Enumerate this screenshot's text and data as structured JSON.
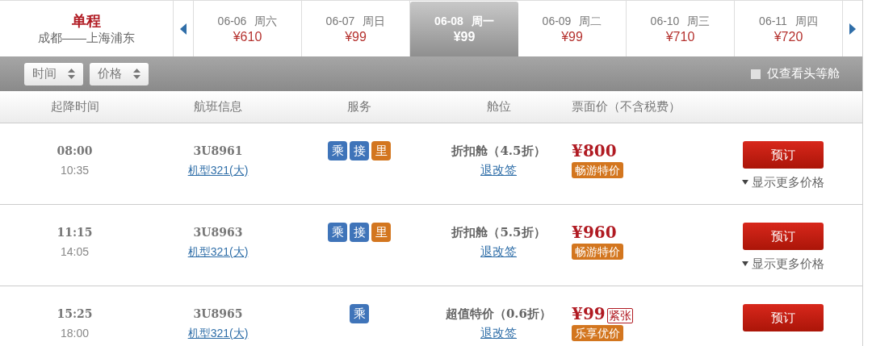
{
  "trip": {
    "type": "单程",
    "route": "成都——上海浦东"
  },
  "dates": [
    {
      "date": "06-06",
      "weekday": "周六",
      "price": "¥610",
      "selected": false
    },
    {
      "date": "06-07",
      "weekday": "周日",
      "price": "¥99",
      "selected": false
    },
    {
      "date": "06-08",
      "weekday": "周一",
      "price": "¥99",
      "selected": true
    },
    {
      "date": "06-09",
      "weekday": "周二",
      "price": "¥99",
      "selected": false
    },
    {
      "date": "06-10",
      "weekday": "周三",
      "price": "¥710",
      "selected": false
    },
    {
      "date": "06-11",
      "weekday": "周四",
      "price": "¥720",
      "selected": false
    }
  ],
  "sort_buttons": [
    "时间",
    "价格"
  ],
  "first_class_filter": {
    "label": "仅查看头等舱",
    "checked": false
  },
  "columns": [
    "起降时间",
    "航班信息",
    "服务",
    "舱位",
    "票面价（不含税费）"
  ],
  "flights": [
    {
      "depart": "08:00",
      "arrive": "10:35",
      "flight_no": "3U8961",
      "aircraft": "机型321(大)",
      "services": [
        {
          "label": "乘",
          "color": "#3f74b9"
        },
        {
          "label": "接",
          "color": "#3f74b9"
        },
        {
          "label": "里",
          "color": "#d3761f"
        }
      ],
      "cabin": "折扣舱（4.5折）",
      "change_link": "退改签",
      "price": "¥800",
      "promo": "畅游特价",
      "book": "预订",
      "more": "显示更多价格"
    },
    {
      "depart": "11:15",
      "arrive": "14:05",
      "flight_no": "3U8963",
      "aircraft": "机型321(大)",
      "services": [
        {
          "label": "乘",
          "color": "#3f74b9"
        },
        {
          "label": "接",
          "color": "#3f74b9"
        },
        {
          "label": "里",
          "color": "#d3761f"
        }
      ],
      "cabin": "折扣舱（5.5折）",
      "change_link": "退改签",
      "price": "¥960",
      "promo": "畅游特价",
      "book": "预订",
      "more": "显示更多价格"
    },
    {
      "depart": "15:25",
      "arrive": "18:00",
      "flight_no": "3U8965",
      "aircraft": "机型321(大)",
      "services": [
        {
          "label": "乘",
          "color": "#3f74b9"
        }
      ],
      "cabin": "超值特价（0.6折）",
      "change_link": "退改签",
      "price": "¥99",
      "scarcity": "紧张",
      "promo": "乐享优价",
      "book": "预订"
    }
  ]
}
